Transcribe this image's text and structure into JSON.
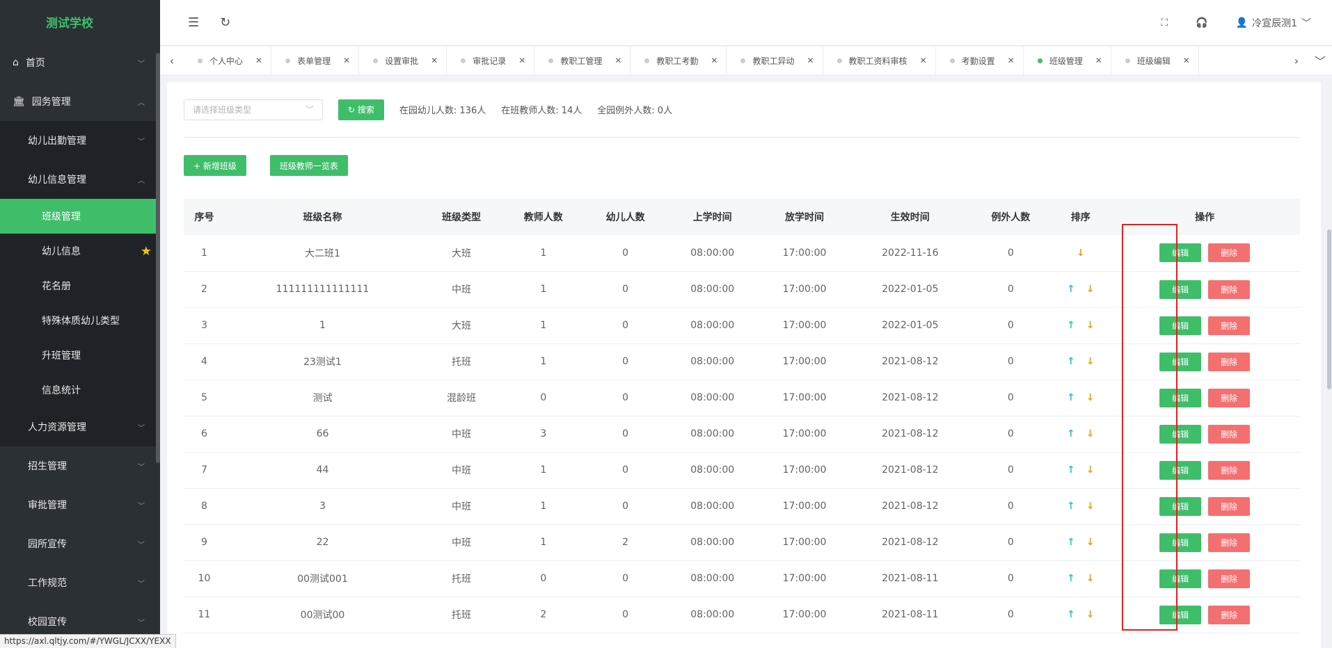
{
  "school": "测试学校",
  "status_url": "https://axl.qltjy.com/#/YWGL/JCXX/YEXX",
  "sidebar": {
    "items": [
      {
        "label": "首页"
      },
      {
        "label": "园务管理"
      }
    ],
    "sub": [
      {
        "label": "幼儿出勤管理"
      },
      {
        "label": "幼儿信息管理"
      }
    ],
    "leaves": [
      {
        "label": "班级管理"
      },
      {
        "label": "幼儿信息"
      },
      {
        "label": "花名册"
      },
      {
        "label": "特殊体质幼儿类型"
      },
      {
        "label": "升班管理"
      },
      {
        "label": "信息统计"
      }
    ],
    "sub_after": [
      {
        "label": "人力资源管理"
      },
      {
        "label": "招生管理"
      },
      {
        "label": "审批管理"
      },
      {
        "label": "园所宣传"
      },
      {
        "label": "工作规范"
      },
      {
        "label": "校园宣传"
      }
    ]
  },
  "header": {
    "user": "冷宣辰测1"
  },
  "tabs": [
    "个人中心",
    "表单管理",
    "设置审批",
    "审批记录",
    "教职工管理",
    "教职工考勤",
    "教职工异动",
    "教职工资料审核",
    "考勤设置",
    "班级管理",
    "班级编辑"
  ],
  "filter": {
    "select_placeholder": "请选择班级类型",
    "search_label": "搜索",
    "stat1": "在园幼儿人数:   136人",
    "stat2": "在班教师人数:   14人",
    "stat3": "全园例外人数:   0人"
  },
  "actions": {
    "add": "+ 新增班级",
    "teachers": "班级教师一览表"
  },
  "table": {
    "headers": [
      "序号",
      "班级名称",
      "班级类型",
      "教师人数",
      "幼儿人数",
      "上学时间",
      "放学时间",
      "生效时间",
      "例外人数",
      "排序",
      "操作"
    ],
    "edit": "编辑",
    "delete": "删除",
    "rows": [
      [
        "1",
        "大二班1",
        "大班",
        "1",
        "0",
        "08:00:00",
        "17:00:00",
        "2022-11-16",
        "0"
      ],
      [
        "2",
        "111111111111111",
        "中班",
        "1",
        "0",
        "08:00:00",
        "17:00:00",
        "2022-01-05",
        "0"
      ],
      [
        "3",
        "1",
        "大班",
        "1",
        "0",
        "08:00:00",
        "17:00:00",
        "2022-01-05",
        "0"
      ],
      [
        "4",
        "23测试1",
        "托班",
        "1",
        "0",
        "08:00:00",
        "17:00:00",
        "2021-08-12",
        "0"
      ],
      [
        "5",
        "测试",
        "混龄班",
        "0",
        "0",
        "08:00:00",
        "17:00:00",
        "2021-08-12",
        "0"
      ],
      [
        "6",
        "66",
        "中班",
        "3",
        "0",
        "08:00:00",
        "17:00:00",
        "2021-08-12",
        "0"
      ],
      [
        "7",
        "44",
        "中班",
        "1",
        "0",
        "08:00:00",
        "17:00:00",
        "2021-08-12",
        "0"
      ],
      [
        "8",
        "3",
        "中班",
        "1",
        "0",
        "08:00:00",
        "17:00:00",
        "2021-08-12",
        "0"
      ],
      [
        "9",
        "22",
        "中班",
        "1",
        "2",
        "08:00:00",
        "17:00:00",
        "2021-08-12",
        "0"
      ],
      [
        "10",
        "00测试001",
        "托班",
        "0",
        "0",
        "08:00:00",
        "17:00:00",
        "2021-08-11",
        "0"
      ],
      [
        "11",
        "00测试00",
        "托班",
        "2",
        "0",
        "08:00:00",
        "17:00:00",
        "2021-08-11",
        "0"
      ]
    ]
  },
  "colors": {
    "accent": "#3fbe6a",
    "danger": "#f46f6f",
    "sidebar": "#2b3035",
    "highlight": "#e02020"
  }
}
